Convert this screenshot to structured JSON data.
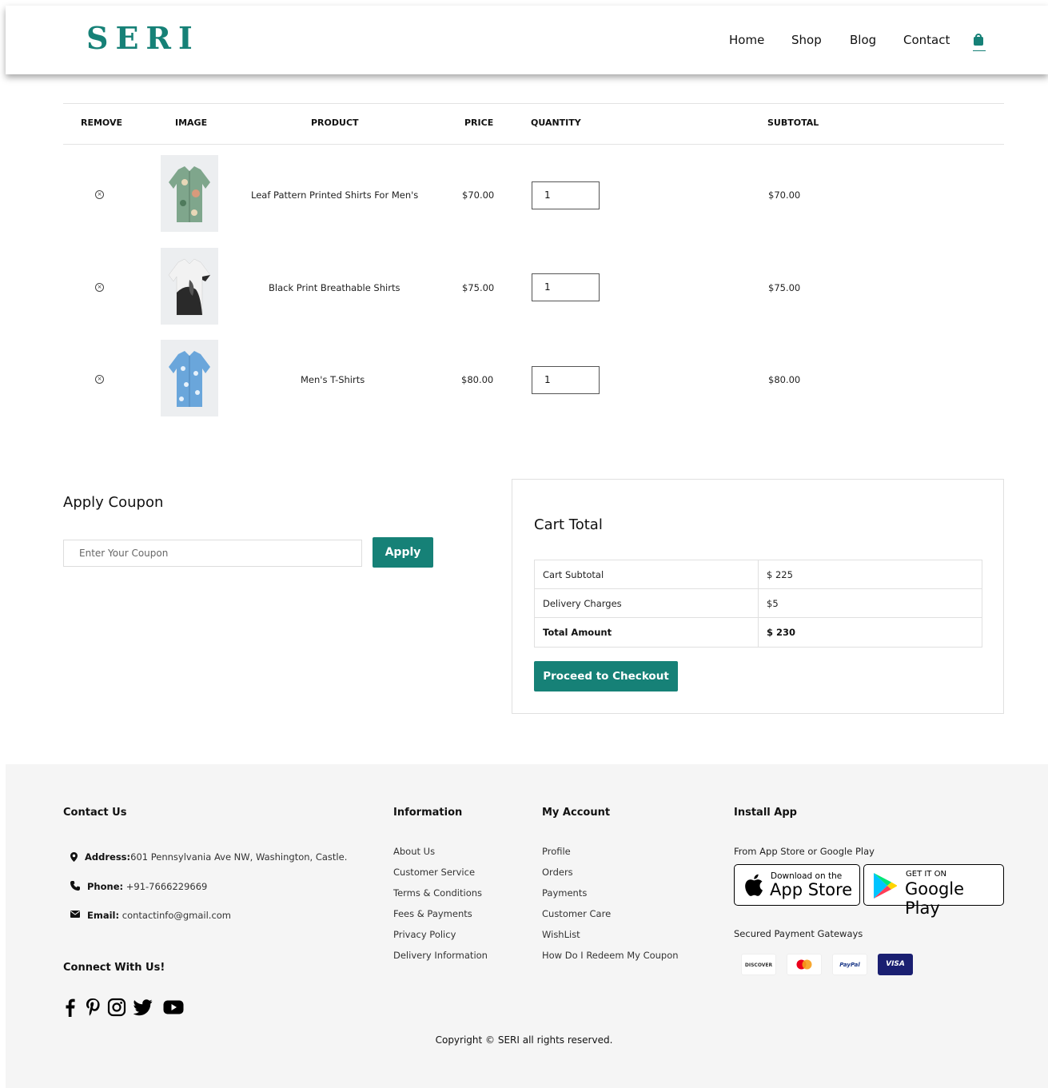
{
  "header": {
    "logo": "SERI",
    "nav": [
      "Home",
      "Shop",
      "Blog",
      "Contact"
    ]
  },
  "cart": {
    "columns": [
      "REMOVE",
      "IMAGE",
      "PRODUCT",
      "PRICE",
      "QUANTITY",
      "SUBTOTAL"
    ],
    "rows": [
      {
        "product": "Leaf Pattern Printed Shirts For Men's",
        "price": "$70.00",
        "quantity": "1",
        "subtotal": "$70.00"
      },
      {
        "product": "Black Print Breathable Shirts",
        "price": "$75.00",
        "quantity": "1",
        "subtotal": "$75.00"
      },
      {
        "product": "Men's T-Shirts",
        "price": "$80.00",
        "quantity": "1",
        "subtotal": "$80.00"
      }
    ]
  },
  "coupon": {
    "title": "Apply Coupon",
    "placeholder": "Enter Your Coupon",
    "button": "Apply"
  },
  "totals": {
    "title": "Cart Total",
    "rows": [
      {
        "label": "Cart Subtotal",
        "value": "$ 225"
      },
      {
        "label": "Delivery Charges",
        "value": "$5"
      },
      {
        "label": "Total Amount",
        "value": "$ 230"
      }
    ],
    "checkout": "Proceed to Checkout"
  },
  "footer": {
    "contact": {
      "heading": "Contact Us",
      "address_label": "Address:",
      "address": "601 Pennsylvania Ave NW, Washington, Castle.",
      "phone_label": "Phone:",
      "phone": " +91-7666229669",
      "email_label": "Email:",
      "email": " contactinfo@gmail.com"
    },
    "connect": "Connect With Us!",
    "information": {
      "heading": "Information",
      "links": [
        "About Us",
        "Customer Service",
        "Terms & Conditions",
        "Fees & Payments",
        "Privacy Policy",
        "Delivery Information"
      ]
    },
    "account": {
      "heading": "My Account",
      "links": [
        "Profile",
        "Orders",
        "Payments",
        "Customer Care",
        "WishList",
        "How Do I Redeem My Coupon"
      ]
    },
    "app": {
      "heading": "Install App",
      "subtitle": "From App Store or Google Play",
      "appstore_small": "Download on the",
      "appstore_big": "App Store",
      "play_small": "GET IT ON",
      "play_big": "Google Play",
      "payments_title": "Secured Payment Gateways",
      "cards": [
        "DISCOVER",
        "mastercard",
        "PayPal",
        "VISA"
      ]
    },
    "copyright": "Copyright © SERI all rights reserved."
  },
  "colors": {
    "accent": "#168177"
  }
}
